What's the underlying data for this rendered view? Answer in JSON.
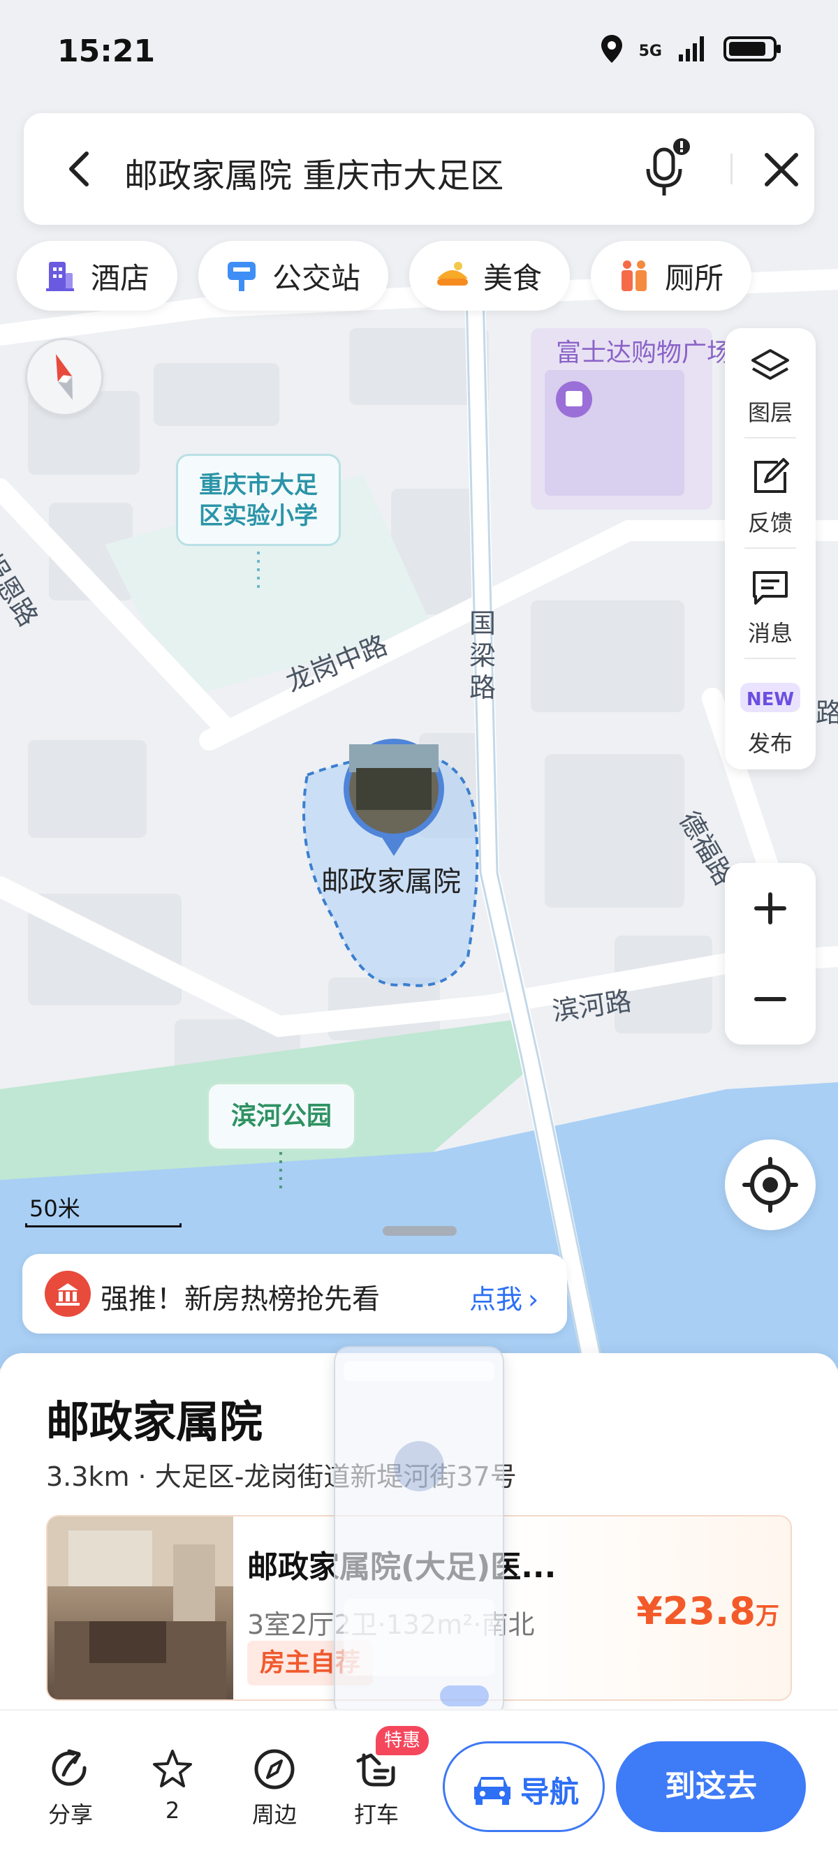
{
  "status": {
    "time": "15:21",
    "network": "5G"
  },
  "search": {
    "query": "邮政家属院 重庆市大足区"
  },
  "categories": [
    {
      "label": "酒店",
      "icon": "hotel-icon"
    },
    {
      "label": "公交站",
      "icon": "bus-stop-icon"
    },
    {
      "label": "美食",
      "icon": "food-icon"
    },
    {
      "label": "厕所",
      "icon": "toilet-icon"
    }
  ],
  "map_labels": {
    "mall": "富士达购物广场",
    "school": "重庆市大足区实验小学",
    "road_baoen": "报恩路",
    "road_longgang": "龙岗中路",
    "road_guoliang": "国梁路",
    "road_binhe": "滨河路",
    "road_defu": "德福路",
    "park": "滨河公园",
    "pin": "邮政家属院",
    "edge_road": "路"
  },
  "sidebar": [
    {
      "label": "图层",
      "icon": "layers-icon"
    },
    {
      "label": "反馈",
      "icon": "feedback-icon"
    },
    {
      "label": "消息",
      "icon": "message-icon"
    },
    {
      "label": "发布",
      "icon": "publish-icon"
    }
  ],
  "scale": {
    "label": "50米"
  },
  "promo": {
    "text": "强推！新房热榜抢先看",
    "cta": "点我"
  },
  "place": {
    "title": "邮政家属院",
    "address": "3.3km · 大足区-龙岗街道新堤河街37号"
  },
  "listing": {
    "name": "邮政家属院(大足)医...",
    "spec": "3室2厅2卫·132m²·南北",
    "tag": "房主自荐",
    "price": "¥23.8",
    "price_unit": "万"
  },
  "bottom_actions": [
    {
      "label": "分享",
      "icon": "share-icon"
    },
    {
      "label": "2",
      "icon": "star-icon"
    },
    {
      "label": "周边",
      "icon": "compass-icon"
    },
    {
      "label": "打车",
      "icon": "taxi-icon"
    }
  ],
  "taxi_badge": "特惠",
  "nav_button": "导航",
  "go_button": "到这去",
  "colors": {
    "accent": "#3e7bf7",
    "price": "#f35a29",
    "park": "#bfe7d3",
    "water": "#a9cff5"
  }
}
